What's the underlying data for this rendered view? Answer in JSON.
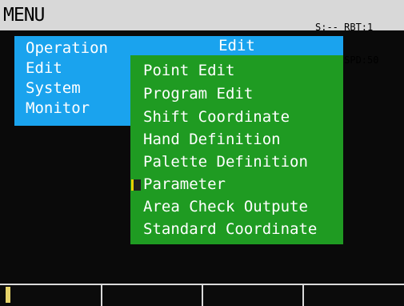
{
  "header": {
    "title": "MENU",
    "status_line1": "S:-- RBT:1",
    "status_line2": "M:-- SPD:50"
  },
  "main_menu": {
    "items": [
      {
        "label": "Operation",
        "selected": false
      },
      {
        "label": "Edit",
        "selected": true
      },
      {
        "label": "System",
        "selected": false
      },
      {
        "label": "Monitor",
        "selected": false
      }
    ]
  },
  "sub_menu": {
    "title": "Edit",
    "items": [
      {
        "label": "Point Edit"
      },
      {
        "label": "Program Edit"
      },
      {
        "label": "Shift Coordinate"
      },
      {
        "label": "Hand Definition"
      },
      {
        "label": "Palette Definition"
      },
      {
        "label": "Parameter",
        "cursor": true
      },
      {
        "label": "Area Check Outpute"
      },
      {
        "label": "Standard Coordinate"
      }
    ]
  },
  "soft_keys": {
    "count": 4
  },
  "colors": {
    "main_menu_bg": "#1aa3ee",
    "sub_menu_bg": "#1f9b22",
    "top_bar_bg": "#d8d8d8",
    "indicator": "#e6d36a"
  }
}
